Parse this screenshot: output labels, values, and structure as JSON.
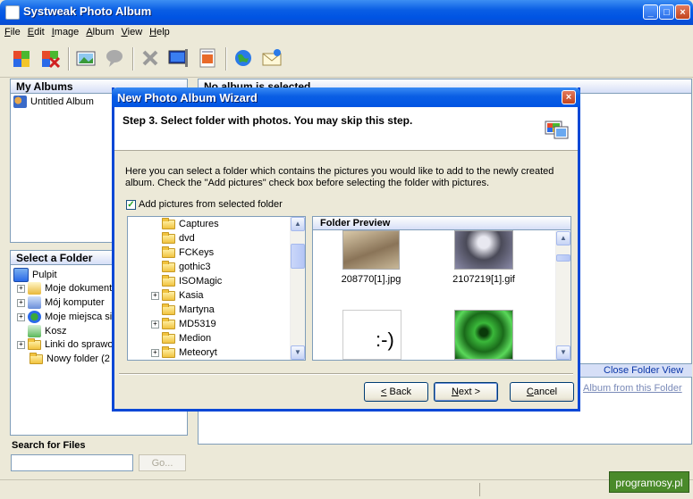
{
  "app": {
    "title": "Systweak Photo Album"
  },
  "menu": [
    "File",
    "Edit",
    "Image",
    "Album",
    "View",
    "Help"
  ],
  "panels": {
    "albums": {
      "title": "My Albums",
      "items": [
        "Untitled Album"
      ]
    },
    "main_header": "No album is selected",
    "folders": {
      "title": "Select a Folder",
      "items": [
        "Pulpit",
        "Moje dokument",
        "Mój komputer",
        "Moje miejsca si",
        "Kosz",
        "Linki do sprawo",
        "Nowy folder (2"
      ]
    },
    "search": {
      "title": "Search for Files",
      "go_label": "Go...",
      "query": ""
    },
    "folder_view": {
      "close_label": "Close Folder View",
      "link": "Album from this Folder"
    }
  },
  "dialog": {
    "title": "New Photo Album Wizard",
    "step": "Step 3. Select folder with photos. You may skip this step.",
    "description": "Here you can select a folder which contains the pictures you would like to add to the newly created album. Check the \"Add pictures\" check box before selecting the folder with pictures.",
    "checkbox_label": "Add pictures from selected folder",
    "checkbox_checked": true,
    "tree": [
      "Captures",
      "dvd",
      "FCKeys",
      "gothic3",
      "ISOMagic",
      "Kasia",
      "Martyna",
      "MD5319",
      "Medion",
      "Meteoryt"
    ],
    "preview": {
      "title": "Folder Preview",
      "files": [
        "208770[1].jpg",
        "2107219[1].gif"
      ],
      "smiley": ":-)"
    },
    "buttons": {
      "back": "< Back",
      "next": "Next >",
      "cancel": "Cancel"
    }
  },
  "watermark": "programosy.pl"
}
